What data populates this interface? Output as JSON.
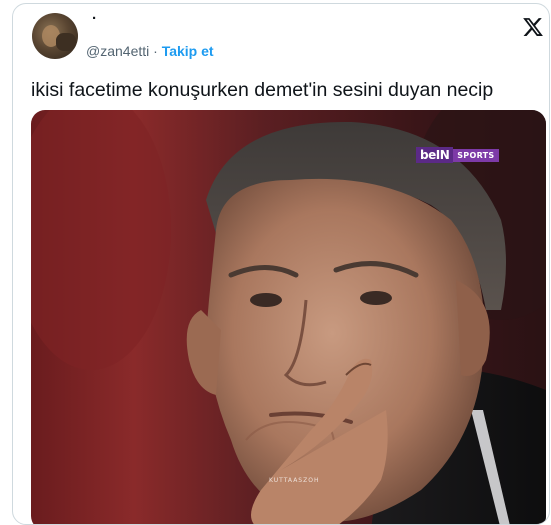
{
  "tweet": {
    "display_name": "·",
    "handle": "@zan4etti",
    "separator": "·",
    "follow_label": "Takip et",
    "text": "ikisi facetime konuşurken demet'in sesini duyan necip",
    "platform_icon": "x-logo-icon"
  },
  "media": {
    "channel_logo_part1": "beIN",
    "channel_logo_part2": "SPORTS",
    "watermark": "KUTTAASZOH"
  },
  "colors": {
    "accent": "#1d9bf0",
    "text": "#0f1419",
    "muted": "#536471",
    "border": "#cfd9de"
  }
}
